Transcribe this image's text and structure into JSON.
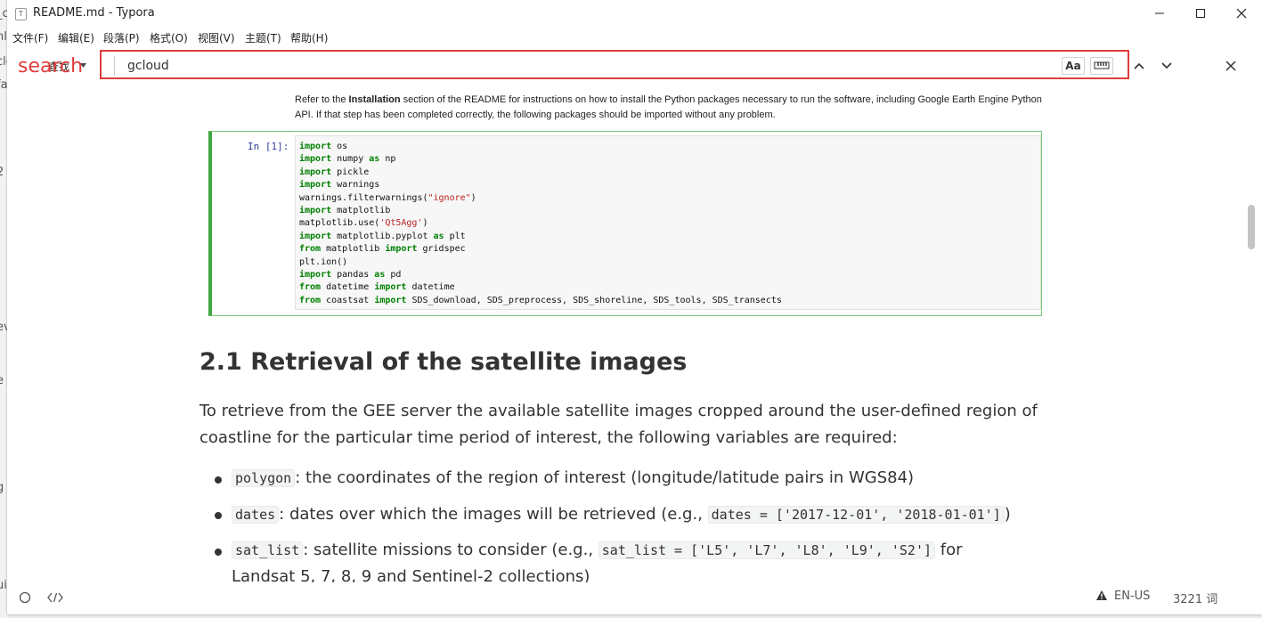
{
  "window": {
    "title": "README.md - Typora",
    "icon_letter": "T",
    "controls": [
      "minimize",
      "maximize",
      "close"
    ]
  },
  "menu": [
    "文件(F)",
    "编辑(E)",
    "段落(P)",
    "格式(O)",
    "视图(V)",
    "主题(T)",
    "帮助(H)"
  ],
  "findbar": {
    "mode_label": "查找",
    "value": "gcloud",
    "annotation_label": "search",
    "case_button_label": "Aa",
    "highlight_color": "#e03b3b"
  },
  "document": {
    "note_prefix": "Refer to the ",
    "note_bold": "Installation",
    "note_suffix": " section of the README for instructions on how to install the Python packages necessary to run the software, including Google Earth Engine Python API. If that step has been completed correctly, the following packages should be imported without any problem.",
    "cell_prompt": "In [1]:",
    "code_lines": [
      [
        {
          "t": "import",
          "k": "kw"
        },
        {
          "t": " os"
        }
      ],
      [
        {
          "t": "import",
          "k": "kw"
        },
        {
          "t": " numpy "
        },
        {
          "t": "as",
          "k": "kw"
        },
        {
          "t": " np"
        }
      ],
      [
        {
          "t": "import",
          "k": "kw"
        },
        {
          "t": " pickle"
        }
      ],
      [
        {
          "t": "import",
          "k": "kw"
        },
        {
          "t": " warnings"
        }
      ],
      [
        {
          "t": "warnings.filterwarnings("
        },
        {
          "t": "\"ignore\"",
          "k": "st"
        },
        {
          "t": ")"
        }
      ],
      [
        {
          "t": "import",
          "k": "kw"
        },
        {
          "t": " matplotlib"
        }
      ],
      [
        {
          "t": "matplotlib.use("
        },
        {
          "t": "'Qt5Agg'",
          "k": "st"
        },
        {
          "t": ")"
        }
      ],
      [
        {
          "t": "import",
          "k": "kw"
        },
        {
          "t": " matplotlib.pyplot "
        },
        {
          "t": "as",
          "k": "kw"
        },
        {
          "t": " plt"
        }
      ],
      [
        {
          "t": "from",
          "k": "kw"
        },
        {
          "t": " matplotlib "
        },
        {
          "t": "import",
          "k": "kw"
        },
        {
          "t": " gridspec"
        }
      ],
      [
        {
          "t": "plt.ion()"
        }
      ],
      [
        {
          "t": "import",
          "k": "kw"
        },
        {
          "t": " pandas "
        },
        {
          "t": "as",
          "k": "kw"
        },
        {
          "t": " pd"
        }
      ],
      [
        {
          "t": "from",
          "k": "kw"
        },
        {
          "t": " datetime "
        },
        {
          "t": "import",
          "k": "kw"
        },
        {
          "t": " datetime"
        }
      ],
      [
        {
          "t": "from",
          "k": "kw"
        },
        {
          "t": " coastsat "
        },
        {
          "t": "import",
          "k": "kw"
        },
        {
          "t": " SDS_download, SDS_preprocess, SDS_shoreline, SDS_tools, SDS_transects"
        }
      ]
    ],
    "heading": "2.1 Retrieval of the satellite images",
    "paragraph": "To retrieve from the GEE server the available satellite images cropped around the user-defined region of coastline for the particular time period of interest, the following variables are required:",
    "list": [
      {
        "code": "polygon",
        "text": ": the coordinates of the region of interest (longitude/latitude pairs in WGS84)"
      },
      {
        "code": "dates",
        "text": ": dates over which the images will be retrieved (e.g., ",
        "code2": "dates = ['2017-12-01', '2018-01-01']",
        "tail": ")"
      },
      {
        "code": "sat_list",
        "text": ": satellite missions to consider (e.g., ",
        "code2": "sat_list = ['L5', 'L7', 'L8', 'L9', 'S2']",
        "tail": " for",
        "line2": "Landsat 5, 7, 8, 9 and Sentinel-2 collections)"
      }
    ]
  },
  "status": {
    "language": "EN-US",
    "word_count": "3221 词"
  },
  "left_strip_fragments": [
    "_c",
    "nl",
    "clo",
    "fa",
    "2",
    "(",
    "ev",
    "e",
    "g",
    "ui"
  ]
}
